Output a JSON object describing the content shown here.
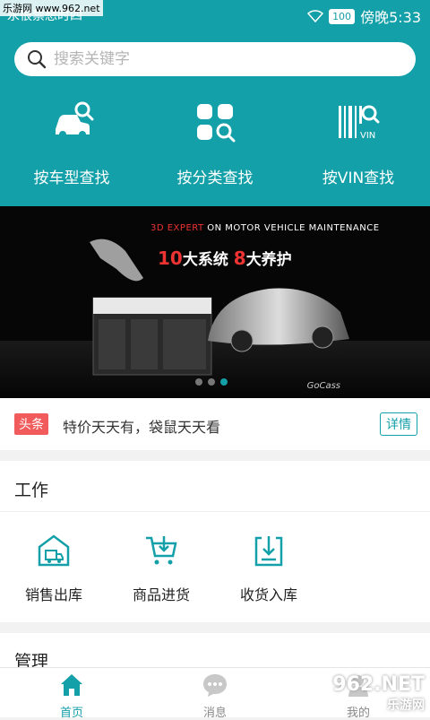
{
  "status": {
    "left_text": "永很禁想时四",
    "battery": "100",
    "time": "傍晚5:33"
  },
  "search": {
    "placeholder": "搜索关键字"
  },
  "quick_find": [
    {
      "label": "按车型查找",
      "icon": "car-search-icon"
    },
    {
      "label": "按分类查找",
      "icon": "category-search-icon"
    },
    {
      "label": "按VIN查找",
      "icon": "vin-barcode-icon"
    }
  ],
  "banner": {
    "headline_prefix": "3D EXPERT",
    "headline_rest": " ON MOTOR VEHICLE MAINTENANCE",
    "main_n1": "10",
    "main_t1": "大系统 ",
    "main_n2": "8",
    "main_t2": "大养护",
    "brand": "GoCass",
    "slides": 3,
    "active_slide": 3
  },
  "news": {
    "tag": "头条",
    "text": "特价天天有，袋鼠天天看",
    "more": "详情"
  },
  "work": {
    "title": "工作",
    "items": [
      {
        "label": "销售出库",
        "icon": "warehouse-truck-icon"
      },
      {
        "label": "商品进货",
        "icon": "cart-download-icon"
      },
      {
        "label": "收货入库",
        "icon": "inbox-download-icon"
      }
    ]
  },
  "manage": {
    "title": "管理"
  },
  "tabs": [
    {
      "label": "首页",
      "icon": "home-icon",
      "active": true
    },
    {
      "label": "消息",
      "icon": "chat-icon",
      "active": false
    },
    {
      "label": "我的",
      "icon": "user-icon",
      "active": false
    }
  ],
  "watermark": {
    "left": "乐游网 www.962.net",
    "right_top": "962.NET",
    "right_bottom": "乐游网"
  },
  "colors": {
    "primary": "#14a0a8",
    "tag_red": "#f25b5b"
  }
}
